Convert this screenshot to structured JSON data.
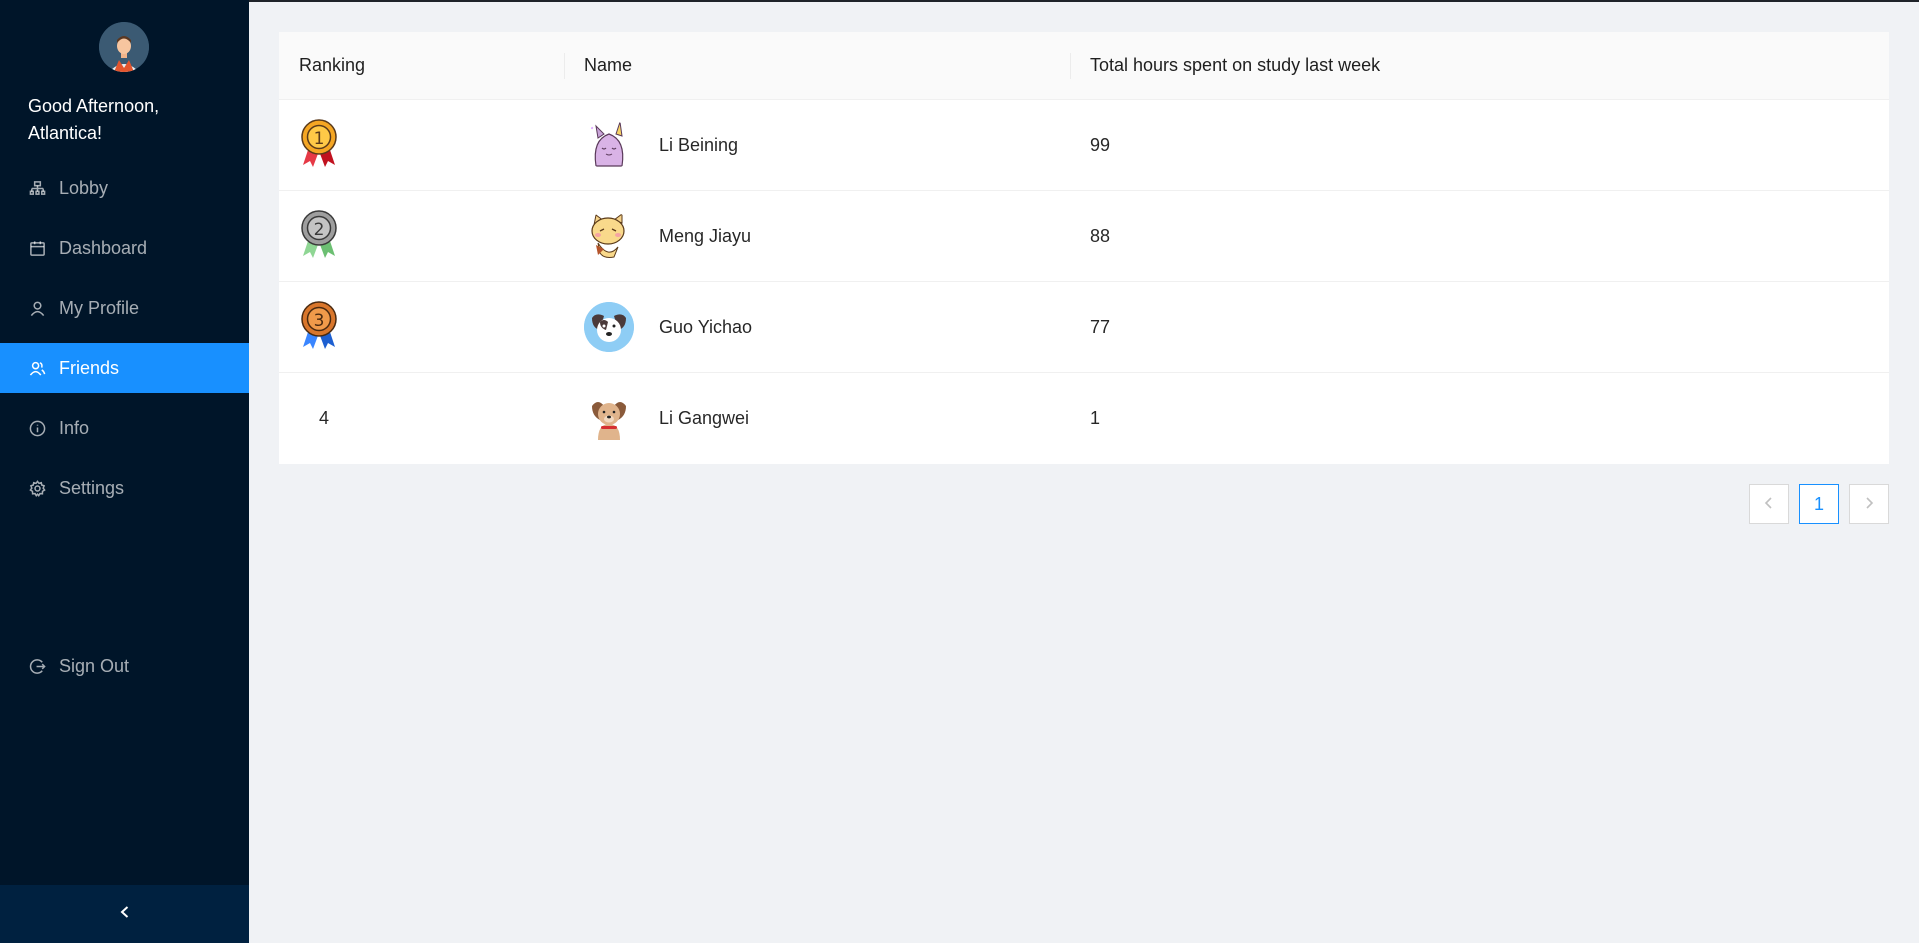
{
  "sidebar": {
    "greeting": "Good Afternoon, Atlantica!",
    "items": [
      {
        "label": "Lobby",
        "icon": "lobby-icon"
      },
      {
        "label": "Dashboard",
        "icon": "calendar-icon"
      },
      {
        "label": "My Profile",
        "icon": "user-icon"
      },
      {
        "label": "Friends",
        "icon": "friends-icon",
        "active": true
      },
      {
        "label": "Info",
        "icon": "info-icon"
      },
      {
        "label": "Settings",
        "icon": "gear-icon"
      }
    ],
    "signout_label": "Sign Out",
    "collapse_icon": "chevron-left-icon"
  },
  "table": {
    "headers": [
      "Ranking",
      "Name",
      "Total hours spent on study last week"
    ],
    "rows": [
      {
        "rank": "1",
        "rank_display": "medal-gold",
        "name": "Li Beining",
        "hours": "99"
      },
      {
        "rank": "2",
        "rank_display": "medal-silver",
        "name": "Meng Jiayu",
        "hours": "88"
      },
      {
        "rank": "3",
        "rank_display": "medal-bronze",
        "name": "Guo Yichao",
        "hours": "77"
      },
      {
        "rank": "4",
        "rank_display": "number",
        "name": "Li Gangwei",
        "hours": "1"
      }
    ]
  },
  "pagination": {
    "current_page": "1"
  },
  "colors": {
    "sidebar_bg": "#001529",
    "accent": "#1890ff",
    "gold": "#f5a623",
    "silver": "#9e9e9e",
    "bronze": "#d9762b"
  }
}
